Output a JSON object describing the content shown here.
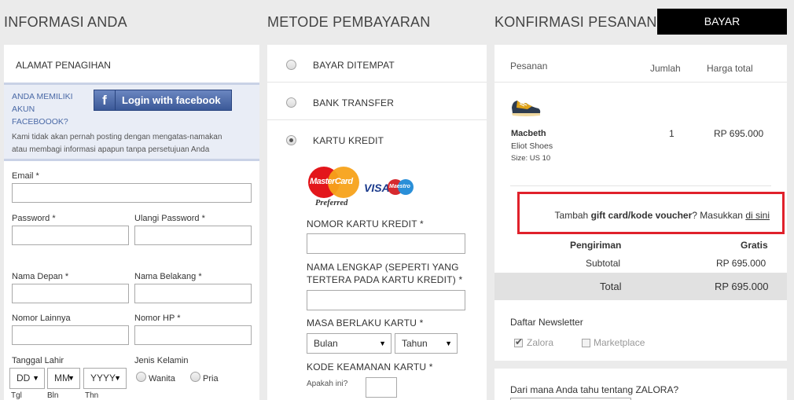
{
  "headers": {
    "info": "INFORMASI ANDA",
    "payment": "METODE PEMBAYARAN",
    "confirm": "KONFIRMASI PESANAN",
    "pay_button": "BAYAR"
  },
  "billing": {
    "title": "ALAMAT PENAGIHAN",
    "fb_question_1": "ANDA MEMILIKI",
    "fb_question_2": "AKUN",
    "fb_question_3": "FACEBOOOK?",
    "fb_button": "Login with facebook",
    "fb_note_1": "Kami tidak akan pernah posting dengan mengatas-namakan",
    "fb_note_2": "atau membagi informasi apapun tanpa persetujuan Anda",
    "email": "Email *",
    "password": "Password *",
    "repeat_password": "Ulangi Password *",
    "first_name": "Nama Depan *",
    "last_name": "Nama Belakang *",
    "other_number": "Nomor Lainnya",
    "phone": "Nomor HP *",
    "birth_date": "Tanggal Lahir",
    "gender": "Jenis Kelamin",
    "day_value": "DD",
    "month_value": "MM",
    "year_value": "YYYY",
    "female": "Wanita",
    "male": "Pria",
    "day_caption": "Tgl",
    "month_caption": "Bln",
    "year_caption": "Thn"
  },
  "payment": {
    "methods": [
      "BAYAR DITEMPAT",
      "BANK TRANSFER",
      "KARTU KREDIT"
    ],
    "selected": "KARTU KREDIT",
    "mastercard_text": "MasterCard",
    "preferred_text": "Preferred",
    "visa_text": "VISA",
    "maestro_text": "Maestro",
    "card_number": "NOMOR KARTU KREDIT *",
    "full_name_1": "NAMA LENGKAP (SEPERTI YANG",
    "full_name_2": "TERTERA PADA KARTU KREDIT) *",
    "expiry": "MASA BERLAKU KARTU *",
    "month_placeholder": "Bulan",
    "year_placeholder": "Tahun",
    "security_code": "KODE KEAMANAN KARTU *",
    "whats_this": "Apakah ini?"
  },
  "order": {
    "col_order": "Pesanan",
    "col_qty": "Jumlah",
    "col_total": "Harga total",
    "item": {
      "name": "Macbeth",
      "desc": "Eliot Shoes",
      "size": "Size: US 10",
      "qty": "1",
      "price": "RP 695.000"
    },
    "voucher_prefix": "Tambah ",
    "voucher_bold": "gift card/kode voucher",
    "voucher_mid": "? Masukkan ",
    "voucher_link": "di sini",
    "shipping_label": "Pengiriman",
    "shipping_value": "Gratis",
    "subtotal_label": "Subtotal",
    "subtotal_value": "RP 695.000",
    "total_label": "Total",
    "total_value": "RP 695.000",
    "newsletter_title": "Daftar Newsletter",
    "newsletter_options": [
      "Zalora",
      "Marketplace"
    ],
    "source_question": "Dari mana Anda tahu tentang ZALORA?"
  },
  "colors": {
    "facebook_blue": "#3b5998",
    "highlight_red": "#e0212b",
    "pay_black": "#000000"
  }
}
